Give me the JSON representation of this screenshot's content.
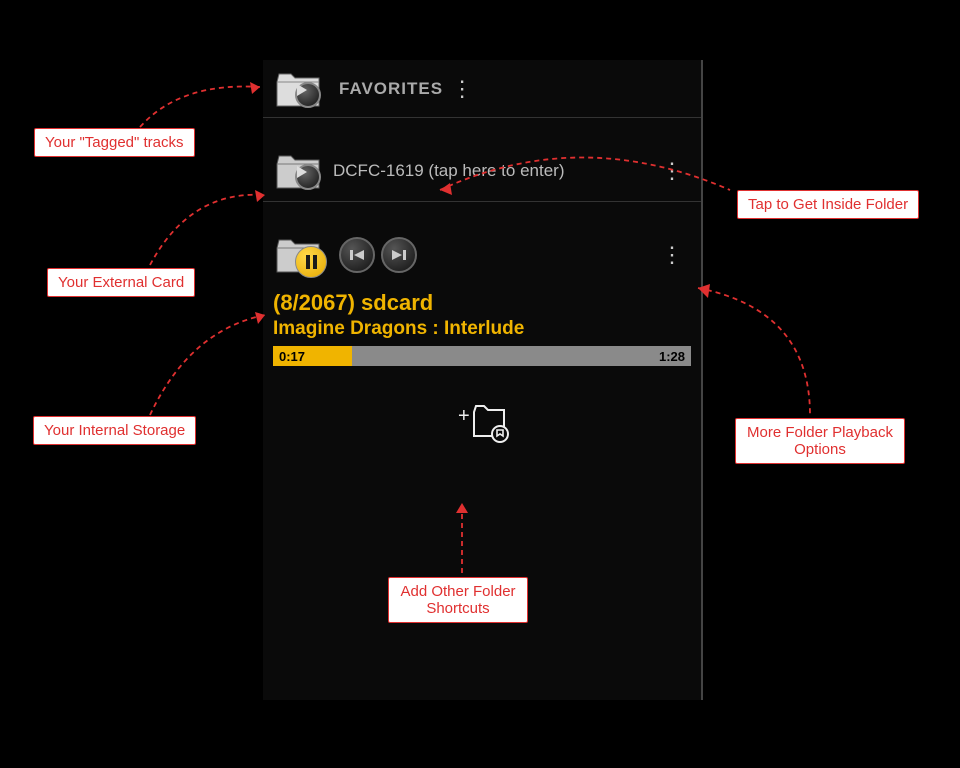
{
  "rows": {
    "favorites": {
      "label": "FAVORITES"
    },
    "folder": {
      "label": "DCFC-1619 (tap here to enter)"
    },
    "player": {
      "counter": "(8/2067)  sdcard",
      "title": "Imagine Dragons : Interlude",
      "elapsed": "0:17",
      "duration": "1:28"
    }
  },
  "callouts": {
    "tagged": "Your \"Tagged\" tracks",
    "external": "Your External Card",
    "internal": "Your Internal Storage",
    "inside": "Tap to Get Inside Folder",
    "options": "More Folder Playback Options",
    "addshortcut": "Add Other Folder Shortcuts"
  }
}
